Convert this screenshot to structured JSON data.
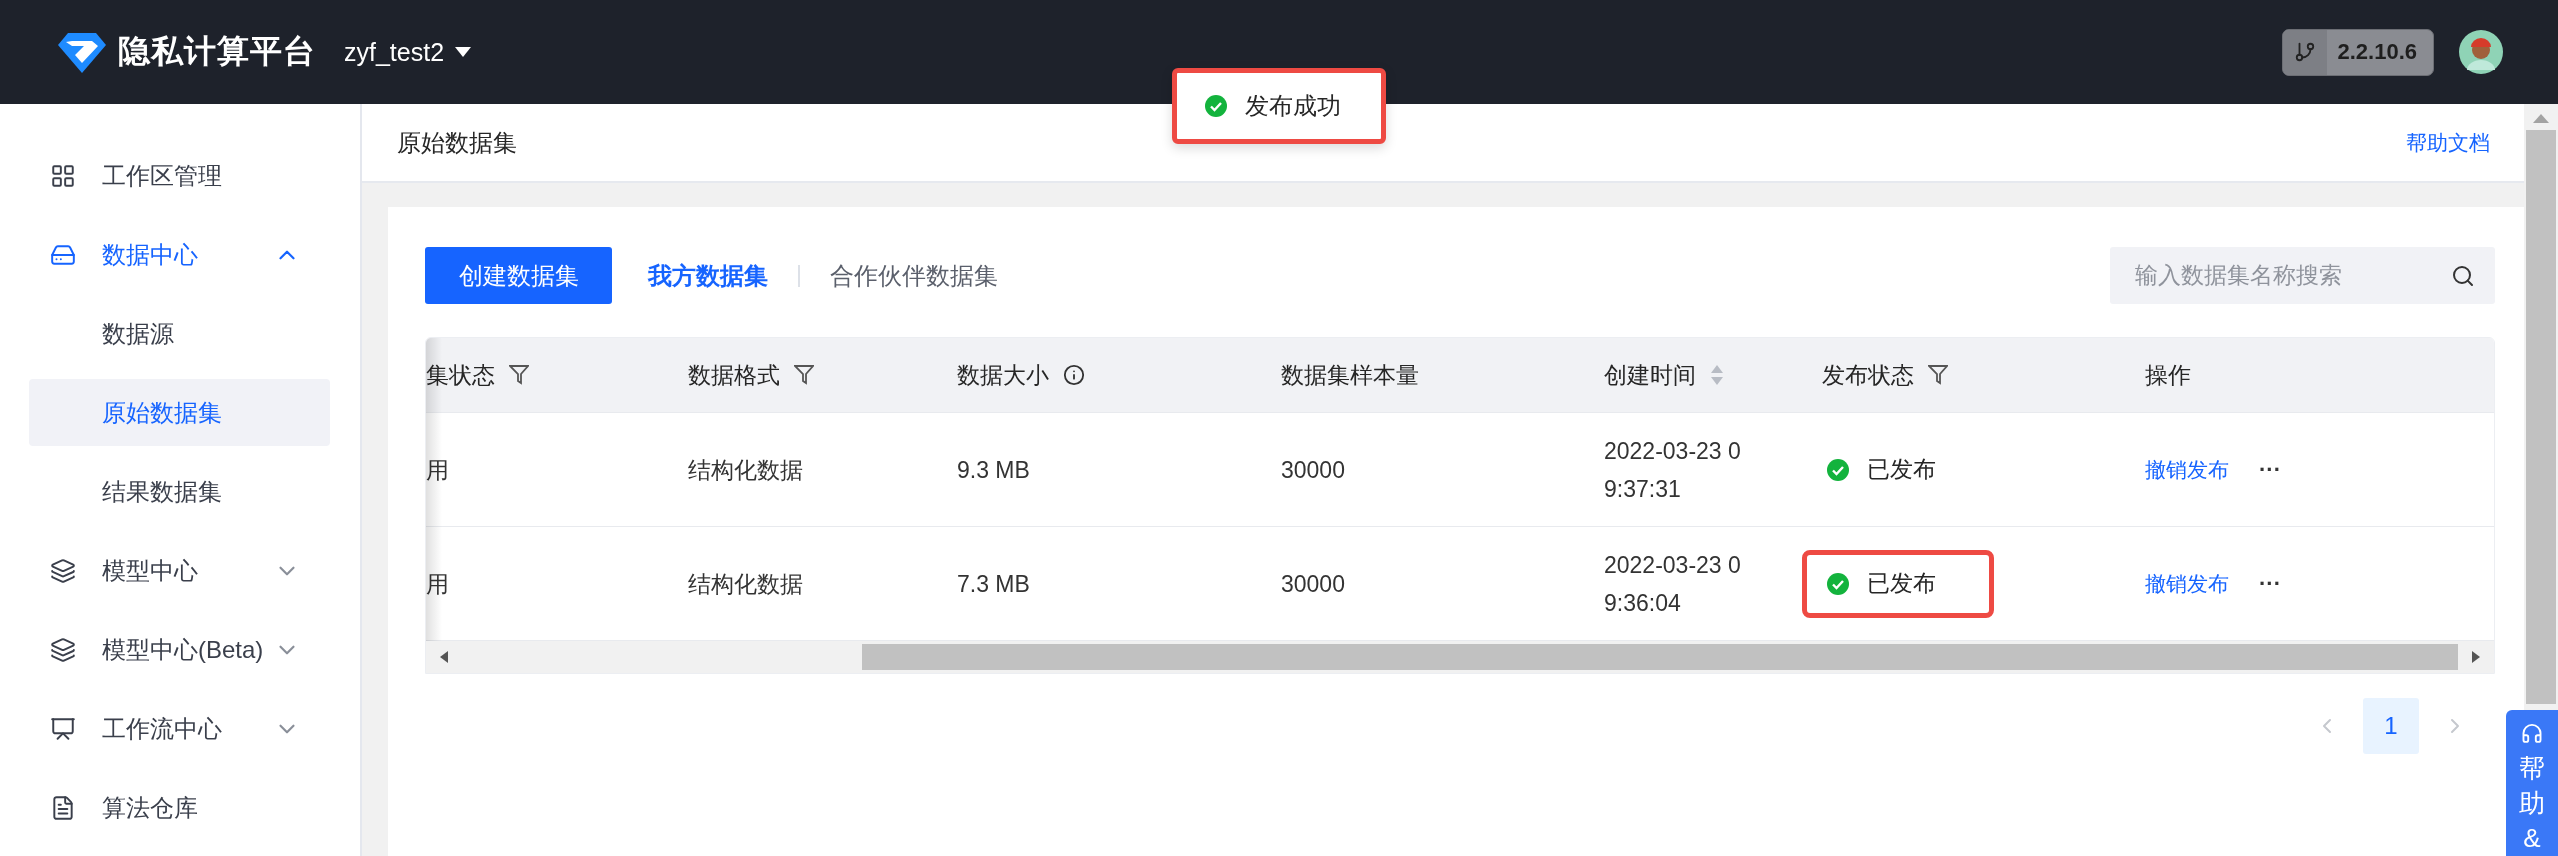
{
  "header": {
    "logo_text": "隐私计算平台",
    "project": "zyf_test2",
    "version": "2.2.10.6"
  },
  "toast": {
    "text": "发布成功",
    "highlighted": true
  },
  "sidebar": {
    "items": [
      {
        "label": "工作区管理",
        "kind": "grid",
        "selected": false
      },
      {
        "label": "数据中心",
        "kind": "drive",
        "selected": false,
        "expanded": true,
        "children": [
          {
            "label": "数据源",
            "selected": false
          },
          {
            "label": "原始数据集",
            "selected": true
          },
          {
            "label": "结果数据集",
            "selected": false
          }
        ]
      },
      {
        "label": "模型中心",
        "kind": "layers",
        "selected": false,
        "expanded": false
      },
      {
        "label": "模型中心(Beta)",
        "kind": "layers",
        "selected": false,
        "expanded": false
      },
      {
        "label": "工作流中心",
        "kind": "monitor",
        "selected": false,
        "expanded": false
      },
      {
        "label": "算法仓库",
        "kind": "file",
        "selected": false
      }
    ]
  },
  "page": {
    "title": "原始数据集",
    "help_link": "帮助文档"
  },
  "toolbar": {
    "create_button": "创建数据集",
    "tabs": [
      {
        "label": "我方数据集",
        "selected": true
      },
      {
        "label": "合作伙伴数据集",
        "selected": false
      }
    ],
    "search": {
      "placeholder": "输入数据集名称搜索"
    }
  },
  "table": {
    "columns": [
      {
        "label": "集状态",
        "kind": "filter"
      },
      {
        "label": "数据格式",
        "kind": "filter"
      },
      {
        "label": "数据大小",
        "kind": "info"
      },
      {
        "label": "数据集样本量",
        "kind": "plain"
      },
      {
        "label": "创建时间",
        "kind": "sort"
      },
      {
        "label": "发布状态",
        "kind": "filter"
      },
      {
        "label": "操作",
        "kind": "plain"
      }
    ],
    "rows": [
      {
        "column_1": "用",
        "format": "结构化数据",
        "size": "9.3 MB",
        "samples": "30000",
        "created": "2022-03-23 09:37:31",
        "status": "已发布",
        "published": true,
        "highlighted": false,
        "action": "撤销发布",
        "more": "···"
      },
      {
        "column_1": "用",
        "format": "结构化数据",
        "size": "7.3 MB",
        "samples": "30000",
        "created": "2022-03-23 09:36:04",
        "status": "已发布",
        "published": true,
        "highlighted": true,
        "action": "撤销发布",
        "more": "···"
      }
    ]
  },
  "pagination": {
    "pages": [
      {
        "label": "1",
        "selected": true
      }
    ]
  },
  "help_float": {
    "text": "帮助&"
  }
}
